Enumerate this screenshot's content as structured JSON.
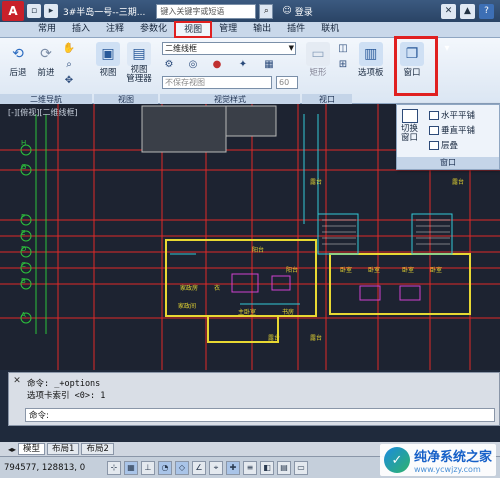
{
  "titlebar": {
    "app_logo": "A",
    "doc_title": "3#半岛一号--三期...",
    "search_placeholder": "键入关键字或短语",
    "login": "登录",
    "help": "?"
  },
  "ribbon_tabs": [
    {
      "label": "常用"
    },
    {
      "label": "插入"
    },
    {
      "label": "注释"
    },
    {
      "label": "参数化"
    },
    {
      "label": "视图"
    },
    {
      "label": "管理"
    },
    {
      "label": "输出"
    },
    {
      "label": "插件"
    },
    {
      "label": "联机"
    }
  ],
  "ribbon": {
    "nav": {
      "back": "后退",
      "forward": "前进",
      "panel": "二维导航"
    },
    "view": {
      "view_btn": "视图",
      "view_manager": "视图\n管理器",
      "panel": "视图"
    },
    "visual": {
      "style_combo": "二维线框",
      "unsaved": "不保存视图",
      "zoom": "60",
      "panel": "视觉样式"
    },
    "viewports": {
      "rect": "矩形",
      "panel": "视口"
    },
    "palettes": {
      "label": "选项板"
    },
    "window": {
      "label": "窗口"
    }
  },
  "popup": {
    "switch_window": "切换\n窗口",
    "tile_h": "水平平铺",
    "tile_v": "垂直平铺",
    "cascade": "层叠",
    "footer": "窗口"
  },
  "canvas": {
    "viewport_title": "[-][俯视][二维线框]",
    "axis_labels": [
      "H",
      "G",
      "F",
      "E",
      "D",
      "C",
      "B",
      "A"
    ]
  },
  "command": {
    "line1": "命令: _+options",
    "line2": "选项卡索引 <0>: 1",
    "prompt": "命令:"
  },
  "layout_tabs": [
    "模型",
    "布局1",
    "布局2"
  ],
  "status": {
    "coords": "794577, 128813, 0"
  },
  "watermark": {
    "title": "纯净系统之家",
    "url": "www.ycwjzy.com"
  },
  "colors": {
    "highlight": "#e02020",
    "canvas_bg": "#1d2331"
  }
}
